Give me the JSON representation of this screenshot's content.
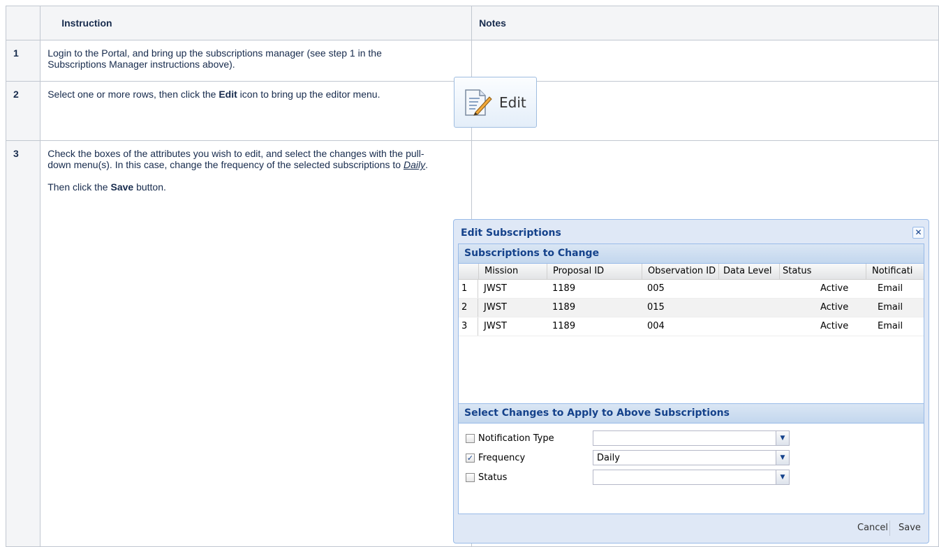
{
  "table": {
    "headers": [
      "",
      "Instruction",
      "Notes"
    ],
    "rows": [
      {
        "num": "1",
        "lines": [
          "Login to the Portal, and bring up the subscriptions manager (see step 1 in the Subscriptions Manager instructions above)."
        ]
      },
      {
        "num": "2",
        "pre": "Select one or more rows, then click the ",
        "bold": "Edit",
        "post": " icon to bring up the editor menu."
      },
      {
        "num": "3",
        "p1_pre": "Check the boxes of the attributes you wish to edit, and select the changes with the pull-down menu(s). In this case, change the frequency of the selected subscriptions to ",
        "p1_em": "Daily",
        "p1_post": ".",
        "p2_pre": "Then click the ",
        "p2_bold": "Save",
        "p2_post": " button."
      }
    ]
  },
  "edit_button": {
    "label": "Edit",
    "icon": "edit-document-icon"
  },
  "dialog": {
    "title": "Edit Subscriptions",
    "close_glyph": "✕",
    "subs_panel_title": "Subscriptions to Change",
    "columns": [
      "Mission",
      "Proposal ID",
      "Observation ID",
      "Data Level",
      "Status",
      "Notificati"
    ],
    "rows": [
      {
        "n": "1",
        "mission": "JWST",
        "proposal": "1189",
        "obs": "005",
        "level": "",
        "status": "Active",
        "notif": "Email"
      },
      {
        "n": "2",
        "mission": "JWST",
        "proposal": "1189",
        "obs": "015",
        "level": "",
        "status": "Active",
        "notif": "Email"
      },
      {
        "n": "3",
        "mission": "JWST",
        "proposal": "1189",
        "obs": "004",
        "level": "",
        "status": "Active",
        "notif": "Email"
      }
    ],
    "changes_panel_title": "Select Changes to Apply to Above Subscriptions",
    "changes": [
      {
        "label": "Notification Type",
        "checked": false,
        "value": ""
      },
      {
        "label": "Frequency",
        "checked": true,
        "value": "Daily"
      },
      {
        "label": "Status",
        "checked": false,
        "value": ""
      }
    ],
    "cancel_label": "Cancel",
    "save_label": "Save"
  }
}
